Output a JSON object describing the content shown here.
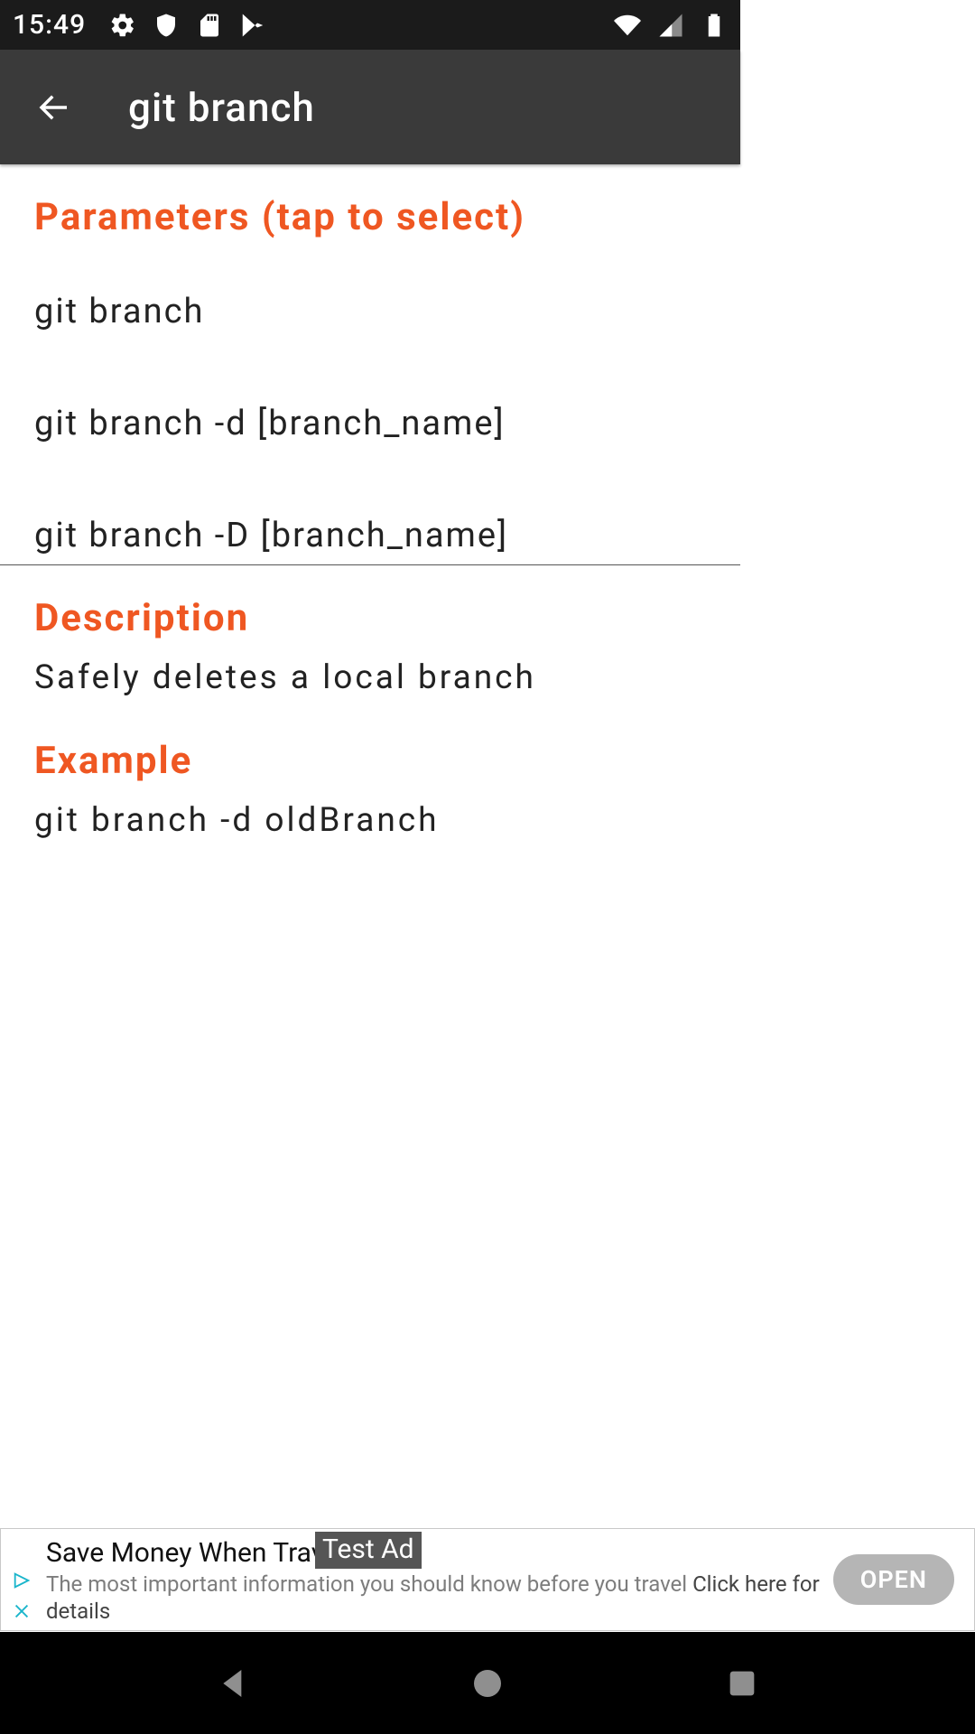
{
  "status": {
    "time": "15:49"
  },
  "appbar": {
    "title": "git branch"
  },
  "sections": {
    "parameters_heading": "Parameters (tap to select)",
    "parameters": [
      "git branch",
      "git branch -d [branch_name]",
      "git branch -D [branch_name]"
    ],
    "description_heading": "Description",
    "description_text": "Safely deletes a local branch",
    "example_heading": "Example",
    "example_text": "git branch -d oldBranch"
  },
  "ad": {
    "title_visible": "Save Money When Trave",
    "badge": "Test Ad",
    "subtitle_line": "The most important information you should know before you travel ",
    "details": "Click here for details",
    "cta": "OPEN"
  }
}
